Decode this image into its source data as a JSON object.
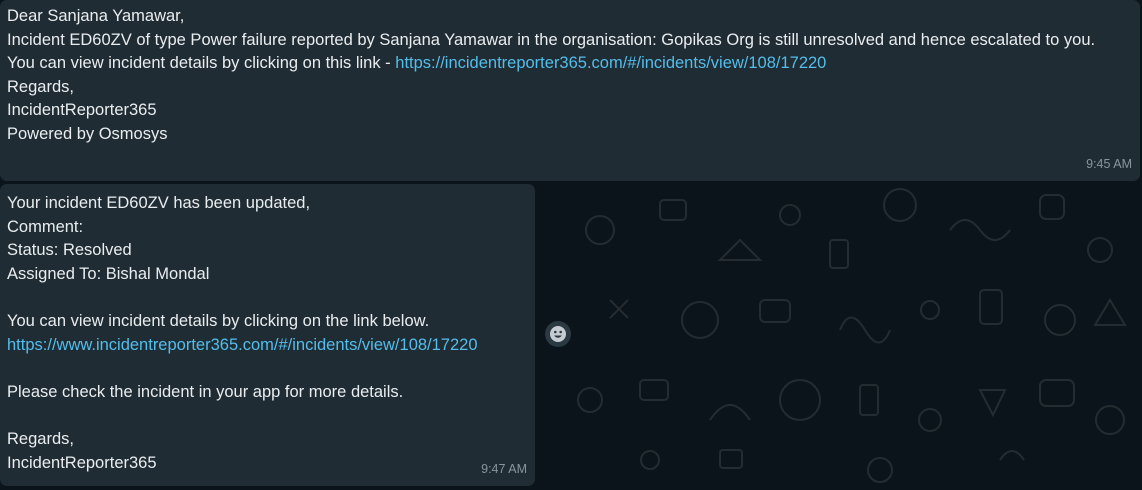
{
  "messages": [
    {
      "lines": [
        "Dear Sanjana Yamawar,",
        "Incident ED60ZV of type Power failure reported by Sanjana Yamawar in the organisation: Gopikas Org is still unresolved and hence escalated to you."
      ],
      "link_prefix": "You can view incident details by clicking on this link - ",
      "link": "https://incidentreporter365.com/#/incidents/view/108/17220",
      "closing": [
        "Regards,",
        "IncidentReporter365",
        "Powered by Osmosys"
      ],
      "time": "9:45 AM"
    },
    {
      "lines": [
        "Your incident ED60ZV has been updated,",
        "Comment:",
        "Status: Resolved",
        "Assigned To: Bishal Mondal"
      ],
      "link_intro": "You can view incident details by clicking on the link below.",
      "link": "https://www.incidentreporter365.com/#/incidents/view/108/17220",
      "note": "Please check the incident in your app for more details.",
      "closing": [
        "Regards,",
        "IncidentReporter365"
      ],
      "time": "9:47 AM"
    }
  ],
  "reaction_icon": "emoji-smile-icon",
  "colors": {
    "background": "#0b141a",
    "bubble": "#202c33",
    "text": "#e9edef",
    "link": "#53bdeb",
    "timestamp": "#8696a0"
  }
}
